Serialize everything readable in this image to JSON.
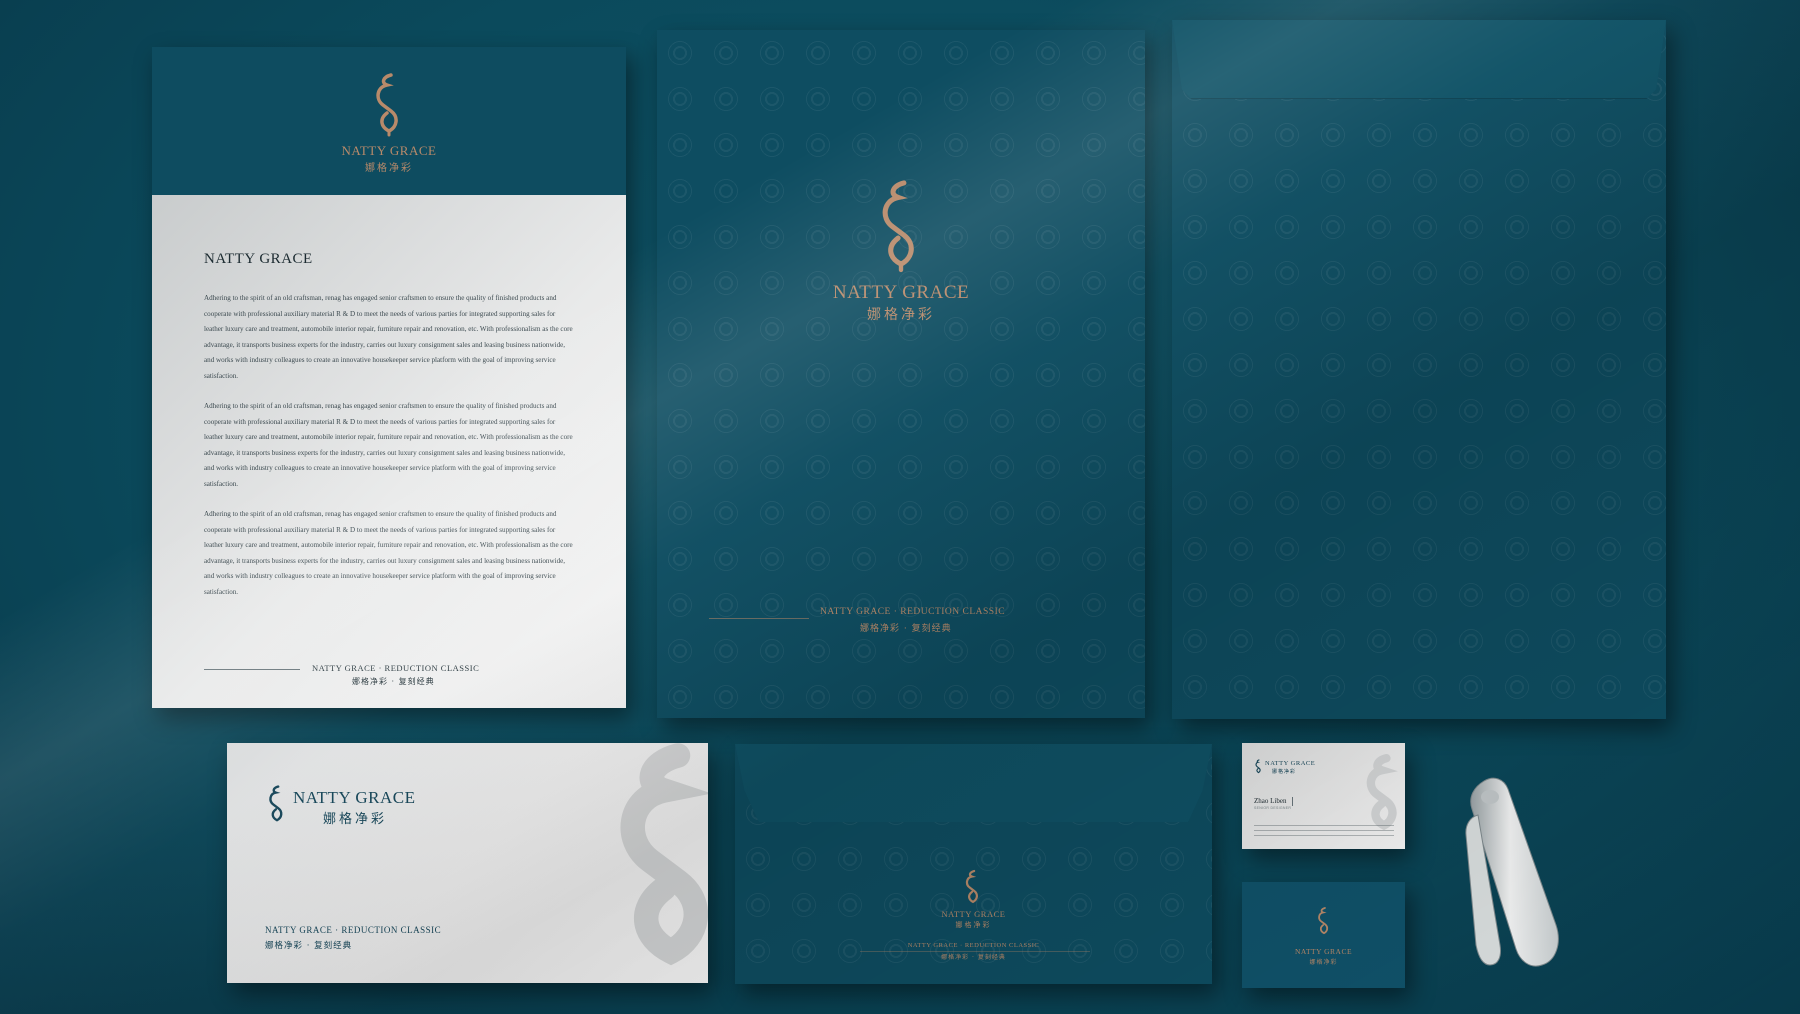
{
  "brand": {
    "name": "NATTY GRACE",
    "name_cn": "娜格净彩",
    "tagline": "NATTY GRACE · REDUCTION CLASSIC",
    "tagline_cn": "娜格净彩 · 复刻经典"
  },
  "letterhead": {
    "title": "NATTY GRACE",
    "paragraphs": [
      "Adhering to the spirit of an old craftsman, renag has engaged senior craftsmen to ensure the quality of finished products and cooperate with professional auxiliary material R & D to meet the needs of various parties for integrated supporting sales for leather luxury care and treatment, automobile interior repair, furniture repair and renovation, etc. With professionalism as the core advantage, it transports business experts for the industry, carries out luxury consignment sales and leasing business nationwide, and works with industry colleagues to create an innovative housekeeper service platform with the goal of improving service satisfaction.",
      "Adhering to the spirit of an old craftsman, renag has engaged senior craftsmen to ensure the quality of finished products and cooperate with professional auxiliary material R & D to meet the needs of various parties for integrated supporting sales for leather luxury care and treatment, automobile interior repair, furniture repair and renovation, etc. With professionalism as the core advantage, it transports business experts for the industry, carries out luxury consignment sales and leasing business nationwide, and works with industry colleagues to create an innovative housekeeper service platform with the goal of improving service satisfaction.",
      "Adhering to the spirit of an old craftsman, renag has engaged senior craftsmen to ensure the quality of finished products and cooperate with professional auxiliary material R & D to meet the needs of various parties for integrated supporting sales for leather luxury care and treatment, automobile interior repair, furniture repair and renovation, etc. With professionalism as the core advantage, it transports business experts for the industry, carries out luxury consignment sales and leasing business nationwide, and works with industry colleagues to create an innovative housekeeper service platform with the goal of improving service satisfaction."
    ]
  },
  "business_card": {
    "person_name": "Zhao Liben",
    "person_title": "SENIOR DESIGNER"
  },
  "colors": {
    "teal": "#0e4c60",
    "background": "#0b4a5c",
    "copper": "#b88a6a",
    "paper": "#eeeeee"
  },
  "icons": [
    "natty-grace-logo-icon",
    "stapler-icon"
  ]
}
